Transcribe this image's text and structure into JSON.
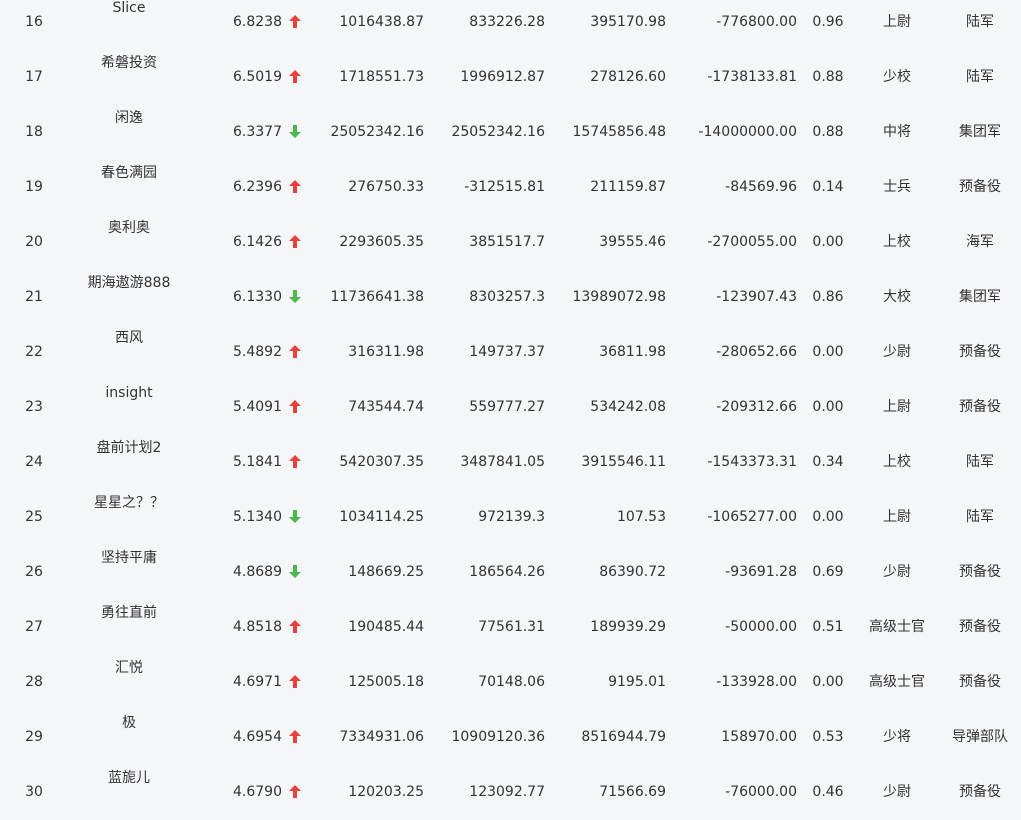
{
  "colors": {
    "up": "#e8413b",
    "down": "#4cb84c",
    "text": "#333333",
    "background": "#f5f6f8"
  },
  "rows": [
    {
      "rank": "16",
      "name": "Slice",
      "score": "6.8238",
      "trend": "up",
      "v1": "1016438.87",
      "v2": "833226.28",
      "v3": "395170.98",
      "v4": "-776800.00",
      "ratio": "0.96",
      "title": "上尉",
      "unit": "陆军"
    },
    {
      "rank": "17",
      "name": "希磐投资",
      "score": "6.5019",
      "trend": "up",
      "v1": "1718551.73",
      "v2": "1996912.87",
      "v3": "278126.60",
      "v4": "-1738133.81",
      "ratio": "0.88",
      "title": "少校",
      "unit": "陆军"
    },
    {
      "rank": "18",
      "name": "闲逸",
      "score": "6.3377",
      "trend": "down",
      "v1": "25052342.16",
      "v2": "25052342.16",
      "v3": "15745856.48",
      "v4": "-14000000.00",
      "ratio": "0.88",
      "title": "中将",
      "unit": "集团军"
    },
    {
      "rank": "19",
      "name": "春色满园",
      "score": "6.2396",
      "trend": "up",
      "v1": "276750.33",
      "v2": "-312515.81",
      "v3": "211159.87",
      "v4": "-84569.96",
      "ratio": "0.14",
      "title": "士兵",
      "unit": "预备役"
    },
    {
      "rank": "20",
      "name": "奥利奥",
      "score": "6.1426",
      "trend": "up",
      "v1": "2293605.35",
      "v2": "3851517.7",
      "v3": "39555.46",
      "v4": "-2700055.00",
      "ratio": "0.00",
      "title": "上校",
      "unit": "海军"
    },
    {
      "rank": "21",
      "name": "期海遨游888",
      "score": "6.1330",
      "trend": "down",
      "v1": "11736641.38",
      "v2": "8303257.3",
      "v3": "13989072.98",
      "v4": "-123907.43",
      "ratio": "0.86",
      "title": "大校",
      "unit": "集团军"
    },
    {
      "rank": "22",
      "name": "西风",
      "score": "5.4892",
      "trend": "up",
      "v1": "316311.98",
      "v2": "149737.37",
      "v3": "36811.98",
      "v4": "-280652.66",
      "ratio": "0.00",
      "title": "少尉",
      "unit": "预备役"
    },
    {
      "rank": "23",
      "name": "insight",
      "score": "5.4091",
      "trend": "up",
      "v1": "743544.74",
      "v2": "559777.27",
      "v3": "534242.08",
      "v4": "-209312.66",
      "ratio": "0.00",
      "title": "上尉",
      "unit": "预备役"
    },
    {
      "rank": "24",
      "name": "盘前计划2",
      "score": "5.1841",
      "trend": "up",
      "v1": "5420307.35",
      "v2": "3487841.05",
      "v3": "3915546.11",
      "v4": "-1543373.31",
      "ratio": "0.34",
      "title": "上校",
      "unit": "陆军"
    },
    {
      "rank": "25",
      "name": "星星之？？",
      "score": "5.1340",
      "trend": "down",
      "v1": "1034114.25",
      "v2": "972139.3",
      "v3": "107.53",
      "v4": "-1065277.00",
      "ratio": "0.00",
      "title": "上尉",
      "unit": "陆军"
    },
    {
      "rank": "26",
      "name": "坚持平庸",
      "score": "4.8689",
      "trend": "down",
      "v1": "148669.25",
      "v2": "186564.26",
      "v3": "86390.72",
      "v4": "-93691.28",
      "ratio": "0.69",
      "title": "少尉",
      "unit": "预备役"
    },
    {
      "rank": "27",
      "name": "勇往直前",
      "score": "4.8518",
      "trend": "up",
      "v1": "190485.44",
      "v2": "77561.31",
      "v3": "189939.29",
      "v4": "-50000.00",
      "ratio": "0.51",
      "title": "高级士官",
      "unit": "预备役"
    },
    {
      "rank": "28",
      "name": "汇悦",
      "score": "4.6971",
      "trend": "up",
      "v1": "125005.18",
      "v2": "70148.06",
      "v3": "9195.01",
      "v4": "-133928.00",
      "ratio": "0.00",
      "title": "高级士官",
      "unit": "预备役"
    },
    {
      "rank": "29",
      "name": "极",
      "score": "4.6954",
      "trend": "up",
      "v1": "7334931.06",
      "v2": "10909120.36",
      "v3": "8516944.79",
      "v4": "158970.00",
      "ratio": "0.53",
      "title": "少将",
      "unit": "导弹部队"
    },
    {
      "rank": "30",
      "name": "蓝旎儿",
      "score": "4.6790",
      "trend": "up",
      "v1": "120203.25",
      "v2": "123092.77",
      "v3": "71566.69",
      "v4": "-76000.00",
      "ratio": "0.46",
      "title": "少尉",
      "unit": "预备役"
    }
  ]
}
